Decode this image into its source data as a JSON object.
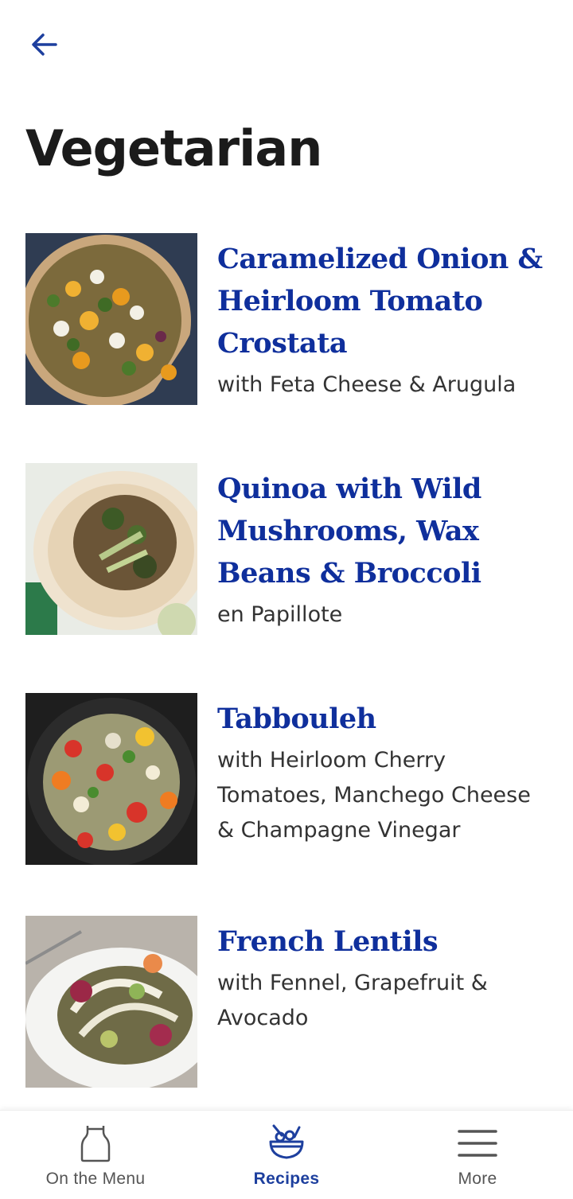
{
  "header": {
    "back_icon": "arrow-left-icon",
    "title": "Vegetarian"
  },
  "recipes": [
    {
      "title": "Caramelized Onion & Heirloom Tomato Crostata",
      "subtitle": "with Feta Cheese & Arugula",
      "image": "crostata-photo"
    },
    {
      "title": "Quinoa with Wild Mushrooms, Wax Beans & Broccoli",
      "subtitle": "en Papillote",
      "image": "quinoa-papillote-photo"
    },
    {
      "title": "Tabbouleh",
      "subtitle": "with Heirloom Cherry Tomatoes, Manchego Cheese & Champagne Vinegar",
      "image": "tabbouleh-photo"
    },
    {
      "title": "French Lentils",
      "subtitle": "with Fennel, Grapefruit & Avocado",
      "image": "lentils-photo"
    }
  ],
  "tabbar": {
    "tabs": [
      {
        "label": "On the Menu",
        "icon": "apron-icon",
        "active": false
      },
      {
        "label": "Recipes",
        "icon": "bowl-icon",
        "active": true
      },
      {
        "label": "More",
        "icon": "menu-icon",
        "active": false
      }
    ]
  },
  "colors": {
    "accent": "#0f2f9c",
    "tab_active": "#1d3f9e",
    "tab_inactive": "#555555",
    "text": "#1b1b1b"
  }
}
